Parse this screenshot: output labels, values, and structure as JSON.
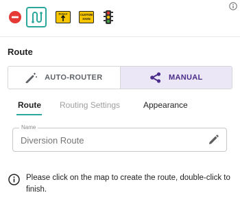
{
  "toolbar": {
    "remove_icon": "remove-circle-icon",
    "route_icon": "route-path-icon",
    "detour_sign_icon": "detour-sign-icon",
    "detour_sign_label": "Detour",
    "custom_sign_icon": "custom-sign-icon",
    "custom_sign_label": "CUSTOM",
    "custom_sign_sublabel": "XXXN",
    "traffic_signal_icon": "traffic-signal-icon",
    "info_icon": "info-icon",
    "accent_color": "#2aa79b"
  },
  "route_section": {
    "title": "Route",
    "modes": [
      {
        "label": "AUTO-ROUTER",
        "icon": "magic-wand-icon",
        "selected": false
      },
      {
        "label": "MANUAL",
        "icon": "share-nodes-icon",
        "selected": true
      }
    ],
    "selected_color": "#4a2d8a",
    "selected_bg": "#ece7f6"
  },
  "tabs": [
    {
      "label": "Route",
      "active": true
    },
    {
      "label": "Routing Settings",
      "active": false,
      "disabled": true
    },
    {
      "label": "Appearance",
      "active": false
    }
  ],
  "name_field": {
    "label": "Name",
    "value": "Diversion Route",
    "edit_icon": "pencil-icon"
  },
  "info_message": {
    "icon": "info-circle-icon",
    "text": "Please click on the map to create the route, double-click to finish."
  }
}
